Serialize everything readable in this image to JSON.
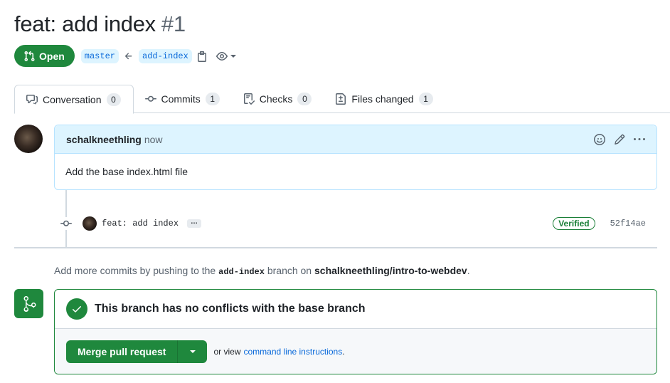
{
  "pr": {
    "title": "feat: add index",
    "number": "#1",
    "state": "Open",
    "base_branch": "master",
    "head_branch": "add-index"
  },
  "tabs": [
    {
      "label": "Conversation",
      "count": "0",
      "icon": "comment-discussion-icon"
    },
    {
      "label": "Commits",
      "count": "1",
      "icon": "git-commit-icon"
    },
    {
      "label": "Checks",
      "count": "0",
      "icon": "checklist-icon"
    },
    {
      "label": "Files changed",
      "count": "1",
      "icon": "file-diff-icon"
    }
  ],
  "comment": {
    "author": "schalkneethling",
    "time": "now",
    "body": "Add the base index.html file"
  },
  "commit": {
    "message": "feat: add index",
    "ellipsis": "…",
    "badge": "Verified",
    "sha": "52f14ae"
  },
  "push_hint": {
    "prefix": "Add more commits by pushing to the",
    "branch": "add-index",
    "middle": "branch on",
    "repo": "schalkneethling/intro-to-webdev",
    "suffix": "."
  },
  "merge": {
    "status": "This branch has no conflicts with the base branch",
    "button_label": "Merge pull request",
    "alt_prefix": "or view",
    "alt_link": "command line instructions",
    "alt_suffix": "."
  },
  "colors": {
    "success": "#1f883d",
    "link": "#0969da",
    "branch_bg": "#ddf4ff"
  }
}
